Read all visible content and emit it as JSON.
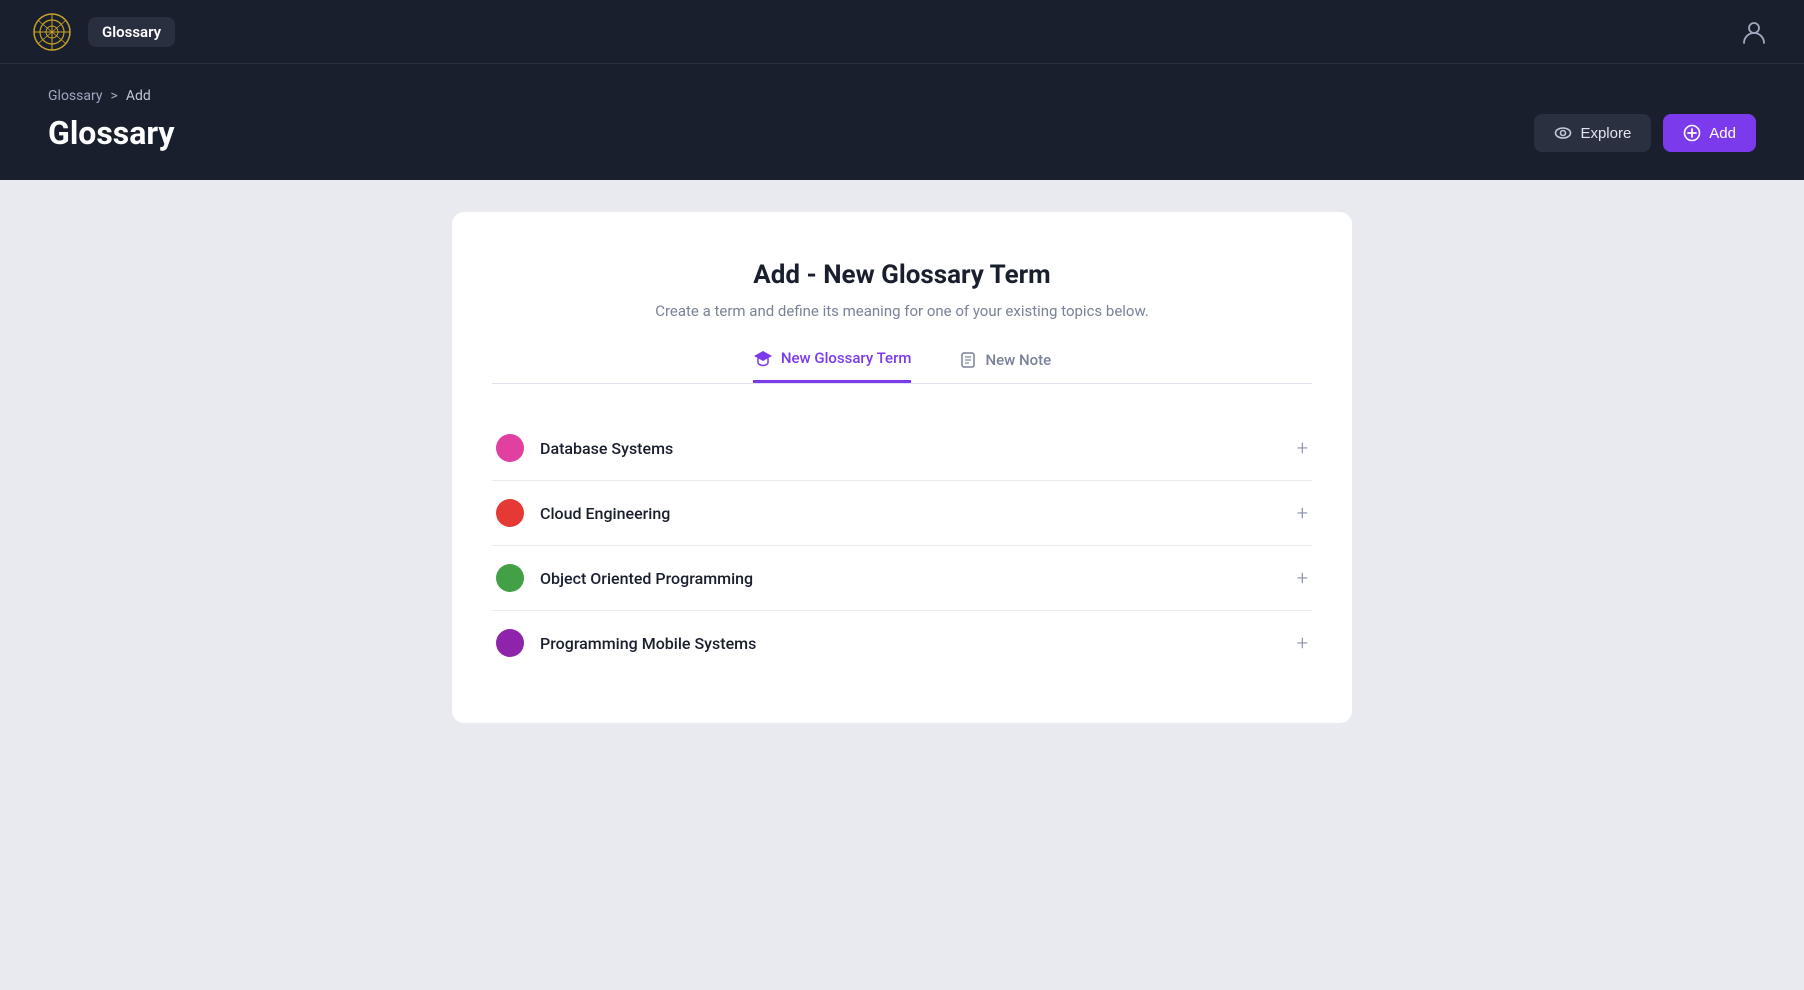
{
  "navbar": {
    "logo_alt": "logo",
    "glossary_badge": "Glossary"
  },
  "breadcrumb": {
    "root": "Glossary",
    "separator": ">",
    "current": "Add"
  },
  "page": {
    "title": "Glossary",
    "explore_label": "Explore",
    "add_label": "Add"
  },
  "card": {
    "title": "Add - New Glossary Term",
    "subtitle": "Create a term and define its meaning for one of your existing topics below.",
    "tabs": [
      {
        "id": "new-glossary-term",
        "label": "New Glossary Term",
        "active": true
      },
      {
        "id": "new-note",
        "label": "New Note",
        "active": false
      }
    ],
    "topics": [
      {
        "name": "Database Systems",
        "color": "#e040a0"
      },
      {
        "name": "Cloud Engineering",
        "color": "#e53935"
      },
      {
        "name": "Object Oriented Programming",
        "color": "#43a047"
      },
      {
        "name": "Programming Mobile Systems",
        "color": "#8e24aa"
      }
    ]
  }
}
